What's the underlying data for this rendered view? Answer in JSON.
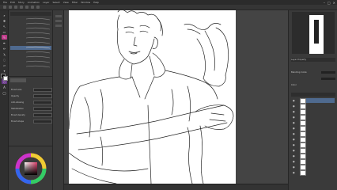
{
  "app": {
    "title": "",
    "menu": [
      "File",
      "Edit",
      "Story",
      "Animation",
      "Layer",
      "Select",
      "View",
      "Filter",
      "Window",
      "Help"
    ]
  },
  "colors": {
    "ui_bg": "#3c3c3c",
    "panel_bg": "#3a3a3a",
    "canvas": "#ffffff",
    "selection": "#4f6a8f",
    "current_color": "#e0406e"
  },
  "tools": [
    {
      "name": "magnifier-icon",
      "glyph": "🔍"
    },
    {
      "name": "move-icon",
      "glyph": "✥"
    },
    {
      "name": "operation-icon",
      "glyph": "↖"
    },
    {
      "name": "select-icon",
      "glyph": "▭"
    },
    {
      "name": "eyedropper-icon",
      "glyph": "✎"
    },
    {
      "name": "pen-icon",
      "glyph": "✒"
    },
    {
      "name": "pencil-icon",
      "glyph": "✏"
    },
    {
      "name": "brush-icon",
      "glyph": "🖌"
    },
    {
      "name": "airbrush-icon",
      "glyph": "◌"
    },
    {
      "name": "eraser-icon",
      "glyph": "▱"
    },
    {
      "name": "fill-icon",
      "glyph": "▼"
    },
    {
      "name": "gradient-icon",
      "glyph": "▤"
    },
    {
      "name": "figure-icon",
      "glyph": "◇"
    },
    {
      "name": "text-icon",
      "glyph": "A"
    },
    {
      "name": "balloon-icon",
      "glyph": "◯"
    }
  ],
  "subtool": {
    "items": [
      "",
      "",
      "",
      "",
      "",
      "",
      "",
      "",
      "",
      "",
      ""
    ]
  },
  "toolprop": {
    "header": "",
    "rows": [
      "Brush size",
      "Opacity",
      "Anti-aliasing",
      "Stabilization",
      "Brush density",
      "Brush shape"
    ]
  },
  "rightpanel": {
    "rows": [
      "Layer Property",
      "",
      "Blending mode",
      "",
      "Color"
    ],
    "layers": [
      "",
      "",
      "",
      "",
      "",
      "",
      "",
      "",
      "",
      "",
      "",
      "",
      "",
      ""
    ]
  },
  "status": {
    "zoom": "",
    "angle": ""
  }
}
